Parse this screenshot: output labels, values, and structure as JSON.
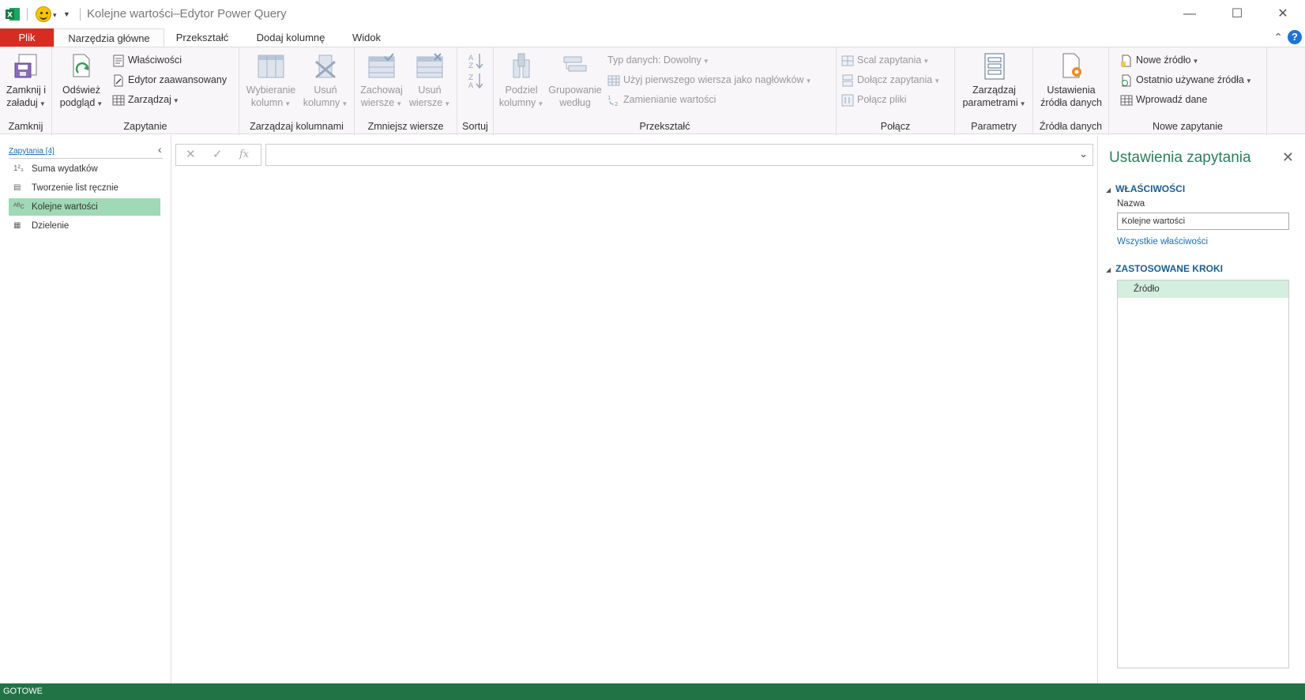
{
  "window": {
    "title": "Kolejne wartości–Edytor Power Query",
    "minimize_glyph": "—",
    "maximize_glyph": "☐",
    "close_glyph": "✕"
  },
  "tabs": {
    "file": "Plik",
    "items": [
      "Narzędzia główne",
      "Przekształć",
      "Dodaj kolumnę",
      "Widok"
    ],
    "help": "?"
  },
  "ribbon": {
    "zamknij": {
      "btn_line1": "Zamknij i",
      "btn_line2": "załaduj",
      "label": "Zamknij"
    },
    "zapytanie": {
      "refresh_line1": "Odśwież",
      "refresh_line2": "podgląd",
      "properties": "Właściwości",
      "advanced_editor": "Edytor zaawansowany",
      "manage": "Zarządzaj",
      "label": "Zapytanie"
    },
    "kolumny": {
      "choose_line1": "Wybieranie",
      "choose_line2": "kolumn",
      "remove_line1": "Usuń",
      "remove_line2": "kolumny",
      "label": "Zarządzaj kolumnami"
    },
    "wiersze": {
      "keep_line1": "Zachowaj",
      "keep_line2": "wiersze",
      "remove_line1": "Usuń",
      "remove_line2": "wiersze",
      "label": "Zmniejsz wiersze"
    },
    "sortuj": {
      "label": "Sortuj"
    },
    "przeksztalc": {
      "split_line1": "Podziel",
      "split_line2": "kolumny",
      "group_line1": "Grupowanie",
      "group_line2": "według",
      "data_type": "Typ danych: Dowolny",
      "first_row": "Użyj pierwszego wiersza jako nagłówków",
      "replace": "Zamienianie wartości",
      "label": "Przekształć"
    },
    "polacz": {
      "merge": "Scal zapytania",
      "append": "Dołącz zapytania",
      "combine": "Połącz pliki",
      "label": "Połącz"
    },
    "parametry": {
      "btn_line1": "Zarządzaj",
      "btn_line2": "parametrami",
      "label": "Parametry"
    },
    "zrodla": {
      "btn_line1": "Ustawienia",
      "btn_line2": "źródła danych",
      "label": "Źródła danych"
    },
    "nowe": {
      "new_source": "Nowe źródło",
      "recent": "Ostatnio używane źródła",
      "enter_data": "Wprowadź dane",
      "label": "Nowe zapytanie"
    }
  },
  "queries": {
    "header": "Zapytania [4]",
    "items": [
      {
        "icon": "1²₃",
        "label": "Suma wydatków"
      },
      {
        "icon": "▤",
        "label": "Tworzenie list ręcznie"
      },
      {
        "icon": "ᴬᴮc",
        "label": "Kolejne wartości"
      },
      {
        "icon": "▦",
        "label": "Dzielenie"
      }
    ]
  },
  "formula": {
    "value": "",
    "fx": "fx"
  },
  "settings": {
    "title": "Ustawienia zapytania",
    "properties_header": "WŁAŚCIWOŚCI",
    "name_label": "Nazwa",
    "name_value": "Kolejne wartości",
    "all_properties": "Wszystkie właściwości",
    "steps_header": "ZASTOSOWANE KROKI",
    "steps": [
      "Źródło"
    ]
  },
  "status": {
    "text": "GOTOWE"
  },
  "colors": {
    "file_tab": "#d72c22",
    "status_bar": "#217346",
    "selection": "#9fd9b5",
    "title_green": "#2e7d5a"
  }
}
